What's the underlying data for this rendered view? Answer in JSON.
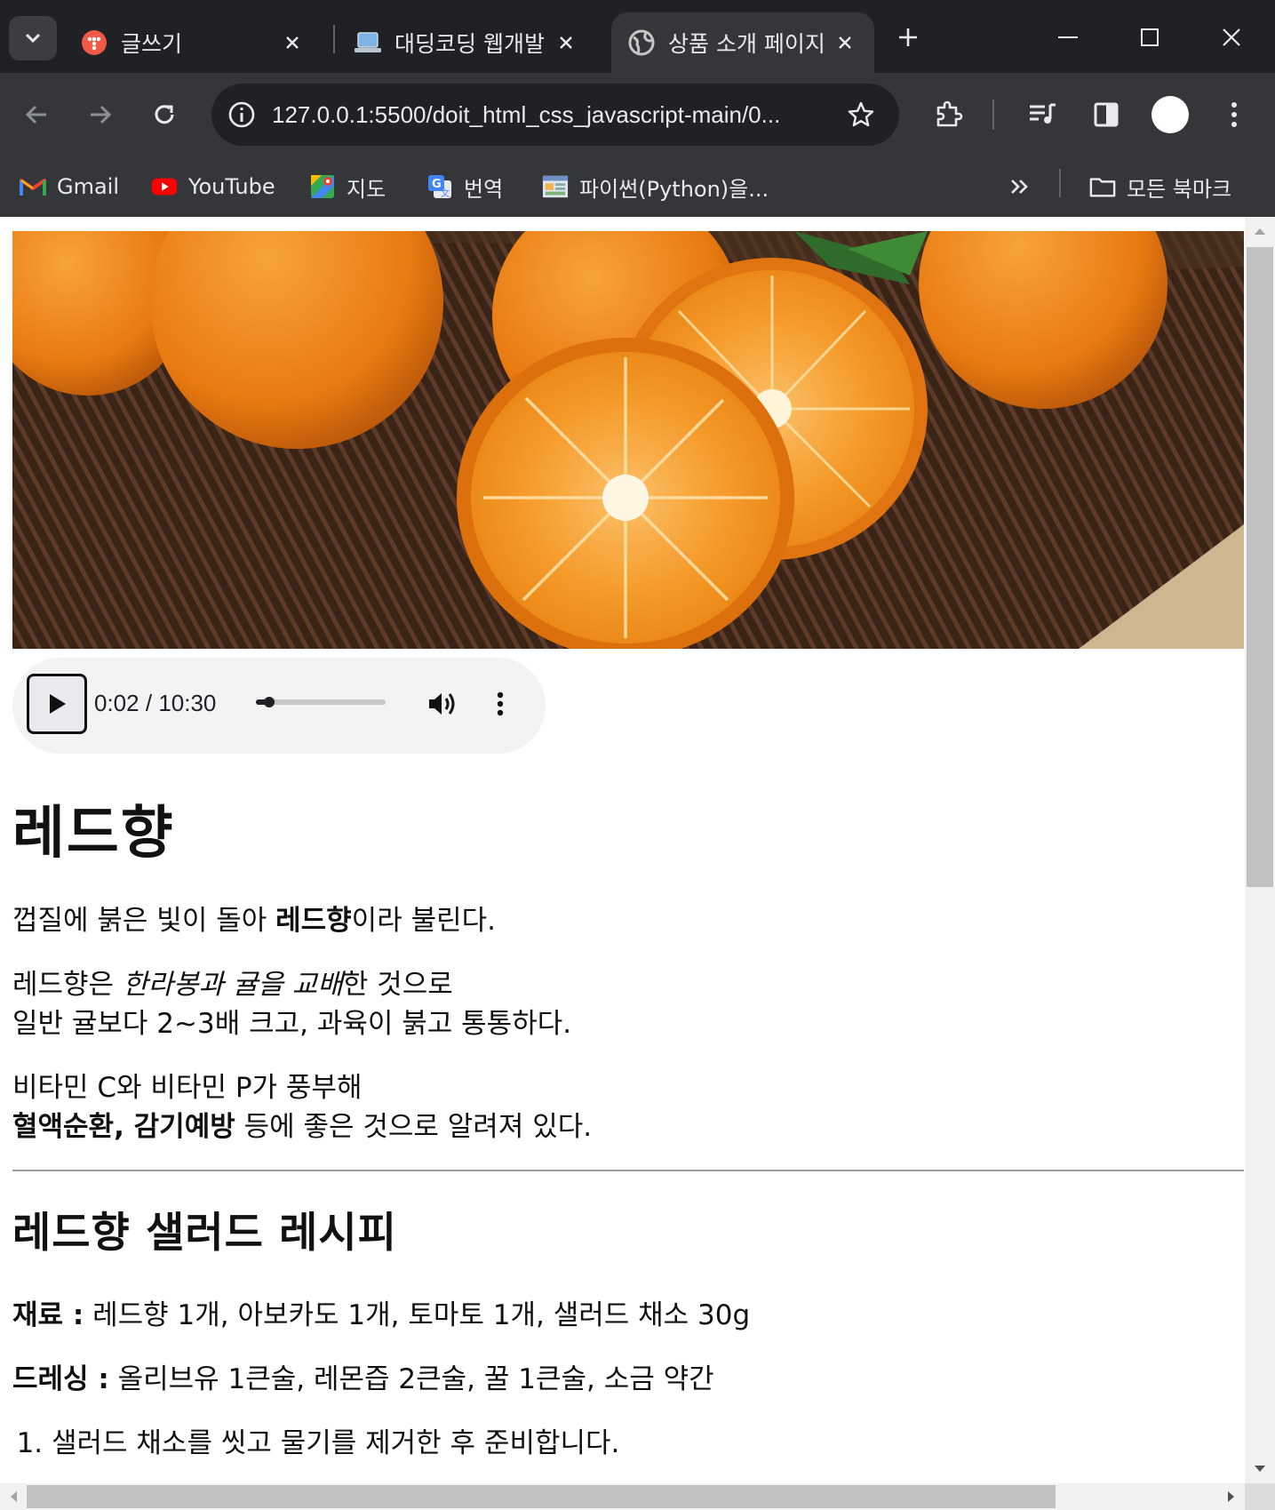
{
  "browser": {
    "tabs": [
      {
        "title": "글쓰기",
        "icon": "tistory-icon",
        "active": false
      },
      {
        "title": "대딩코딩 웹개발",
        "icon": "laptop-icon",
        "active": false
      },
      {
        "title": "상품 소개 페이지",
        "icon": "globe-icon",
        "active": true
      }
    ],
    "url": "127.0.0.1:5500/doit_html_css_javascript-main/0...",
    "bookmarks": [
      {
        "label": "Gmail",
        "icon": "gmail-icon"
      },
      {
        "label": "YouTube",
        "icon": "youtube-icon"
      },
      {
        "label": "지도",
        "icon": "maps-icon"
      },
      {
        "label": "번역",
        "icon": "translate-icon"
      },
      {
        "label": "파이썬(Python)을...",
        "icon": "page-thumbnail-icon"
      }
    ],
    "all_bookmarks_label": "모든 북마크"
  },
  "audio": {
    "current_time": "0:02",
    "separator": "/",
    "duration": "10:30",
    "progress": 0.003
  },
  "page": {
    "title": "레드향",
    "intro": {
      "before": "껍질에 붉은 빛이 돌아 ",
      "bold": "레드향",
      "after": "이라 불린다."
    },
    "para2": {
      "before": "레드향은 ",
      "italic": "한라봉과 귤을 교배",
      "after": "한 것으로",
      "line2": "일반 귤보다 2~3배 크고, 과육이 붉고 통통하다."
    },
    "para3": {
      "line1": "비타민 C와 비타민 P가 풍부해",
      "bold": "혈액순환, 감기예방",
      "after": " 등에 좋은 것으로 알려져 있다."
    },
    "recipe": {
      "title": "레드향 샐러드 레시피",
      "ingredients_label": "재료 :",
      "ingredients": " 레드향 1개, 아보카도 1개, 토마토 1개, 샐러드 채소 30g",
      "dressing_label": "드레싱 :",
      "dressing": " 올리브유 1큰술, 레몬즙 2큰술, 꿀 1큰술, 소금 약간",
      "steps": [
        "샐러드 채소를 씻고 물기를 제거한 후 준비합니다."
      ]
    }
  },
  "colors": {
    "titlebar": "#202124",
    "toolbar": "#35363a",
    "orange": "#f28c1a"
  }
}
